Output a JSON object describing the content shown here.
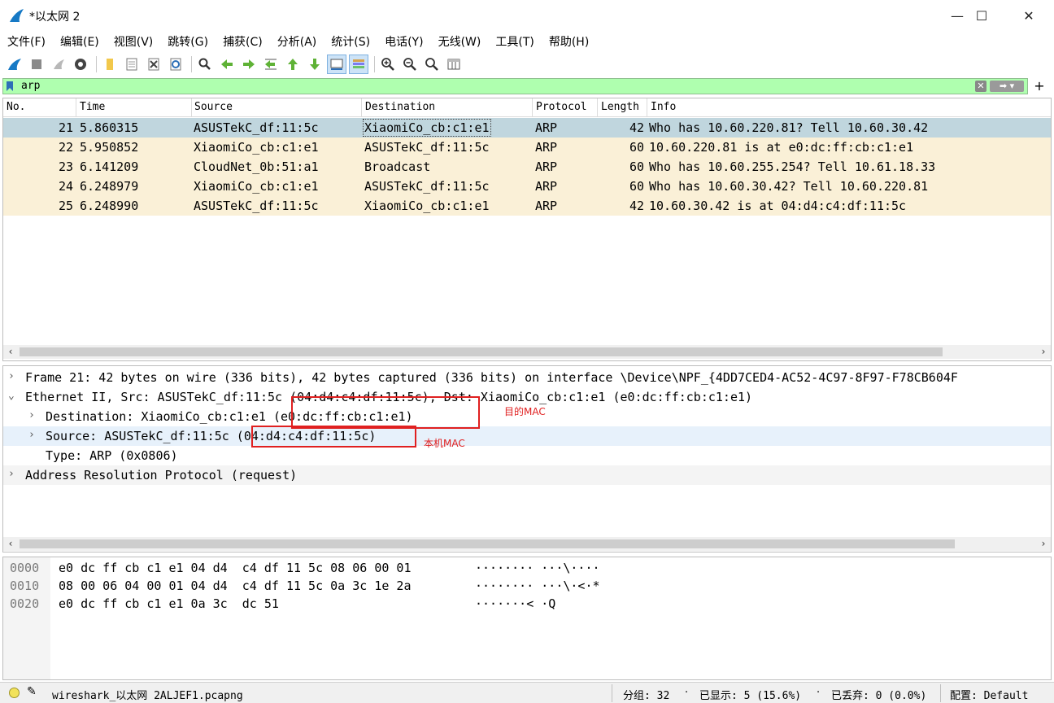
{
  "window": {
    "title": "*以太网 2",
    "controls": {
      "minimize": "—",
      "maximize": "☐",
      "close": "✕"
    }
  },
  "menu": [
    "文件(F)",
    "编辑(E)",
    "视图(V)",
    "跳转(G)",
    "捕获(C)",
    "分析(A)",
    "统计(S)",
    "电话(Y)",
    "无线(W)",
    "工具(T)",
    "帮助(H)"
  ],
  "toolbar": {
    "icons": [
      "start-capture-icon",
      "stop-capture-icon",
      "restart-capture-icon",
      "capture-options-icon",
      "open-file-icon",
      "save-file-icon",
      "close-file-icon",
      "reload-file-icon",
      "find-packet-icon",
      "go-back-icon",
      "go-forward-icon",
      "go-to-packet-icon",
      "first-packet-icon",
      "last-packet-icon",
      "auto-scroll-icon",
      "colorize-icon",
      "zoom-in-icon",
      "zoom-out-icon",
      "normal-size-icon",
      "resize-columns-icon"
    ]
  },
  "filter": {
    "value": "arp",
    "background": "#afffaf",
    "apply_icon": "arrow-right-icon",
    "add_label": "+"
  },
  "packet_list": {
    "columns": [
      "No.",
      "Time",
      "Source",
      "Destination",
      "Protocol",
      "Length",
      "Info"
    ],
    "selected_color": "#c0d6de",
    "arp_color": "#faf0d7",
    "rows": [
      {
        "no": "21",
        "time": "5.860315",
        "source": "ASUSTekC_df:11:5c",
        "destination": "XiaomiCo_cb:c1:e1",
        "protocol": "ARP",
        "length": "42",
        "info": "Who has 10.60.220.81? Tell 10.60.30.42",
        "selected": true
      },
      {
        "no": "22",
        "time": "5.950852",
        "source": "XiaomiCo_cb:c1:e1",
        "destination": "ASUSTekC_df:11:5c",
        "protocol": "ARP",
        "length": "60",
        "info": "10.60.220.81 is at e0:dc:ff:cb:c1:e1",
        "selected": false
      },
      {
        "no": "23",
        "time": "6.141209",
        "source": "CloudNet_0b:51:a1",
        "destination": "Broadcast",
        "protocol": "ARP",
        "length": "60",
        "info": "Who has 10.60.255.254? Tell 10.61.18.33",
        "selected": false
      },
      {
        "no": "24",
        "time": "6.248979",
        "source": "XiaomiCo_cb:c1:e1",
        "destination": "ASUSTekC_df:11:5c",
        "protocol": "ARP",
        "length": "60",
        "info": "Who has 10.60.30.42? Tell 10.60.220.81",
        "selected": false
      },
      {
        "no": "25",
        "time": "6.248990",
        "source": "ASUSTekC_df:11:5c",
        "destination": "XiaomiCo_cb:c1:e1",
        "protocol": "ARP",
        "length": "42",
        "info": "10.60.30.42 is at 04:d4:c4:df:11:5c",
        "selected": false
      }
    ]
  },
  "details": {
    "rows": [
      {
        "text": "Frame 21: 42 bytes on wire (336 bits), 42 bytes captured (336 bits) on interface \\Device\\NPF_{4DD7CED4-AC52-4C97-8F97-F78CB604F",
        "expanded": false
      },
      {
        "text": "Ethernet II, Src: ASUSTekC_df:11:5c (04:d4:c4:df:11:5c), Dst: XiaomiCo_cb:c1:e1 (e0:dc:ff:cb:c1:e1)",
        "expanded": true
      },
      {
        "text": "Destination: XiaomiCo_cb:c1:e1 (e0:dc:ff:cb:c1:e1)",
        "expanded": false
      },
      {
        "text": "Source: ASUSTekC_df:11:5c (04:d4:c4:df:11:5c)",
        "expanded": false
      },
      {
        "text": "Type: ARP (0x0806)",
        "expanded": null
      },
      {
        "text": "Address Resolution Protocol (request)",
        "expanded": false
      }
    ],
    "annotations": {
      "dest_mac": "目的MAC",
      "local_mac": "本机MAC"
    }
  },
  "bytes": {
    "lines": [
      {
        "offset": "0000",
        "hex": "e0 dc ff cb c1 e1 04 d4  c4 df 11 5c 08 06 00 01",
        "ascii": "········ ···\\····"
      },
      {
        "offset": "0010",
        "hex": "08 00 06 04 00 01 04 d4  c4 df 11 5c 0a 3c 1e 2a",
        "ascii": "········ ···\\·<·*"
      },
      {
        "offset": "0020",
        "hex": "e0 dc ff cb c1 e1 0a 3c  dc 51",
        "ascii": "·······< ·Q"
      }
    ]
  },
  "status": {
    "file": "wireshark_以太网 2ALJEF1.pcapng",
    "packets": "分组: 32",
    "displayed": "已显示: 5 (15.6%)",
    "dropped": "已丢弃: 0 (0.0%)",
    "profile": "配置: Default"
  }
}
